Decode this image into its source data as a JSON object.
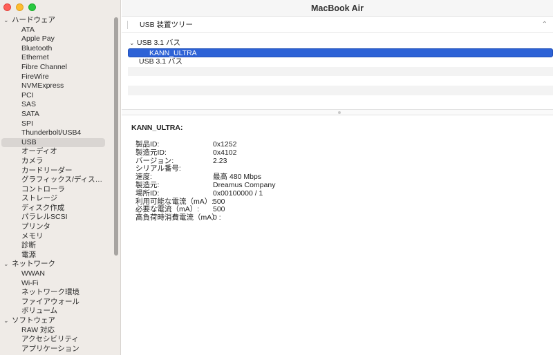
{
  "window": {
    "title": "MacBook Air"
  },
  "sidebar": {
    "items": [
      {
        "type": "group",
        "label": "ハードウェア"
      },
      {
        "type": "item",
        "label": "ATA"
      },
      {
        "type": "item",
        "label": "Apple Pay"
      },
      {
        "type": "item",
        "label": "Bluetooth"
      },
      {
        "type": "item",
        "label": "Ethernet"
      },
      {
        "type": "item",
        "label": "Fibre Channel"
      },
      {
        "type": "item",
        "label": "FireWire"
      },
      {
        "type": "item",
        "label": "NVMExpress"
      },
      {
        "type": "item",
        "label": "PCI"
      },
      {
        "type": "item",
        "label": "SAS"
      },
      {
        "type": "item",
        "label": "SATA"
      },
      {
        "type": "item",
        "label": "SPI"
      },
      {
        "type": "item",
        "label": "Thunderbolt/USB4"
      },
      {
        "type": "item",
        "label": "USB",
        "selected": true
      },
      {
        "type": "item",
        "label": "オーディオ"
      },
      {
        "type": "item",
        "label": "カメラ"
      },
      {
        "type": "item",
        "label": "カードリーダー"
      },
      {
        "type": "item",
        "label": "グラフィックス/ディス…"
      },
      {
        "type": "item",
        "label": "コントローラ"
      },
      {
        "type": "item",
        "label": "ストレージ"
      },
      {
        "type": "item",
        "label": "ディスク作成"
      },
      {
        "type": "item",
        "label": "パラレルSCSI"
      },
      {
        "type": "item",
        "label": "プリンタ"
      },
      {
        "type": "item",
        "label": "メモリ"
      },
      {
        "type": "item",
        "label": "診断"
      },
      {
        "type": "item",
        "label": "電源"
      },
      {
        "type": "group",
        "label": "ネットワーク"
      },
      {
        "type": "item",
        "label": "WWAN"
      },
      {
        "type": "item",
        "label": "Wi-Fi"
      },
      {
        "type": "item",
        "label": "ネットワーク環境"
      },
      {
        "type": "item",
        "label": "ファイアウォール"
      },
      {
        "type": "item",
        "label": "ボリューム"
      },
      {
        "type": "group",
        "label": "ソフトウェア"
      },
      {
        "type": "item",
        "label": "RAW 対応"
      },
      {
        "type": "item",
        "label": "アクセシビリティ"
      },
      {
        "type": "item",
        "label": "アプリケーション"
      }
    ]
  },
  "section": {
    "title": "USB 装置ツリー"
  },
  "usb_tree": {
    "bus1": "USB 3.1 バス",
    "device": "KANN_ULTRA",
    "bus2": "USB 3.1 バス"
  },
  "detail": {
    "title": "KANN_ULTRA:",
    "rows": [
      {
        "key": "製品ID:",
        "value": "0x1252"
      },
      {
        "key": "製造元ID:",
        "value": "0x4102"
      },
      {
        "key": "バージョン:",
        "value": "2.23"
      },
      {
        "key": "シリアル番号:",
        "value": ""
      },
      {
        "key": "速度:",
        "value": "最高 480 Mbps"
      },
      {
        "key": "製造元:",
        "value": "Dreamus Company"
      },
      {
        "key": "場所ID:",
        "value": "0x00100000 / 1"
      },
      {
        "key": "利用可能な電流（mA）:",
        "value": "500"
      },
      {
        "key": "必要な電流（mA）:",
        "value": "500"
      },
      {
        "key": "高負荷時消費電流（mA）:",
        "value": "0"
      }
    ]
  },
  "icons": {
    "chevron_down": "⌄",
    "chevron_right": "›",
    "collapse": "⌃"
  }
}
